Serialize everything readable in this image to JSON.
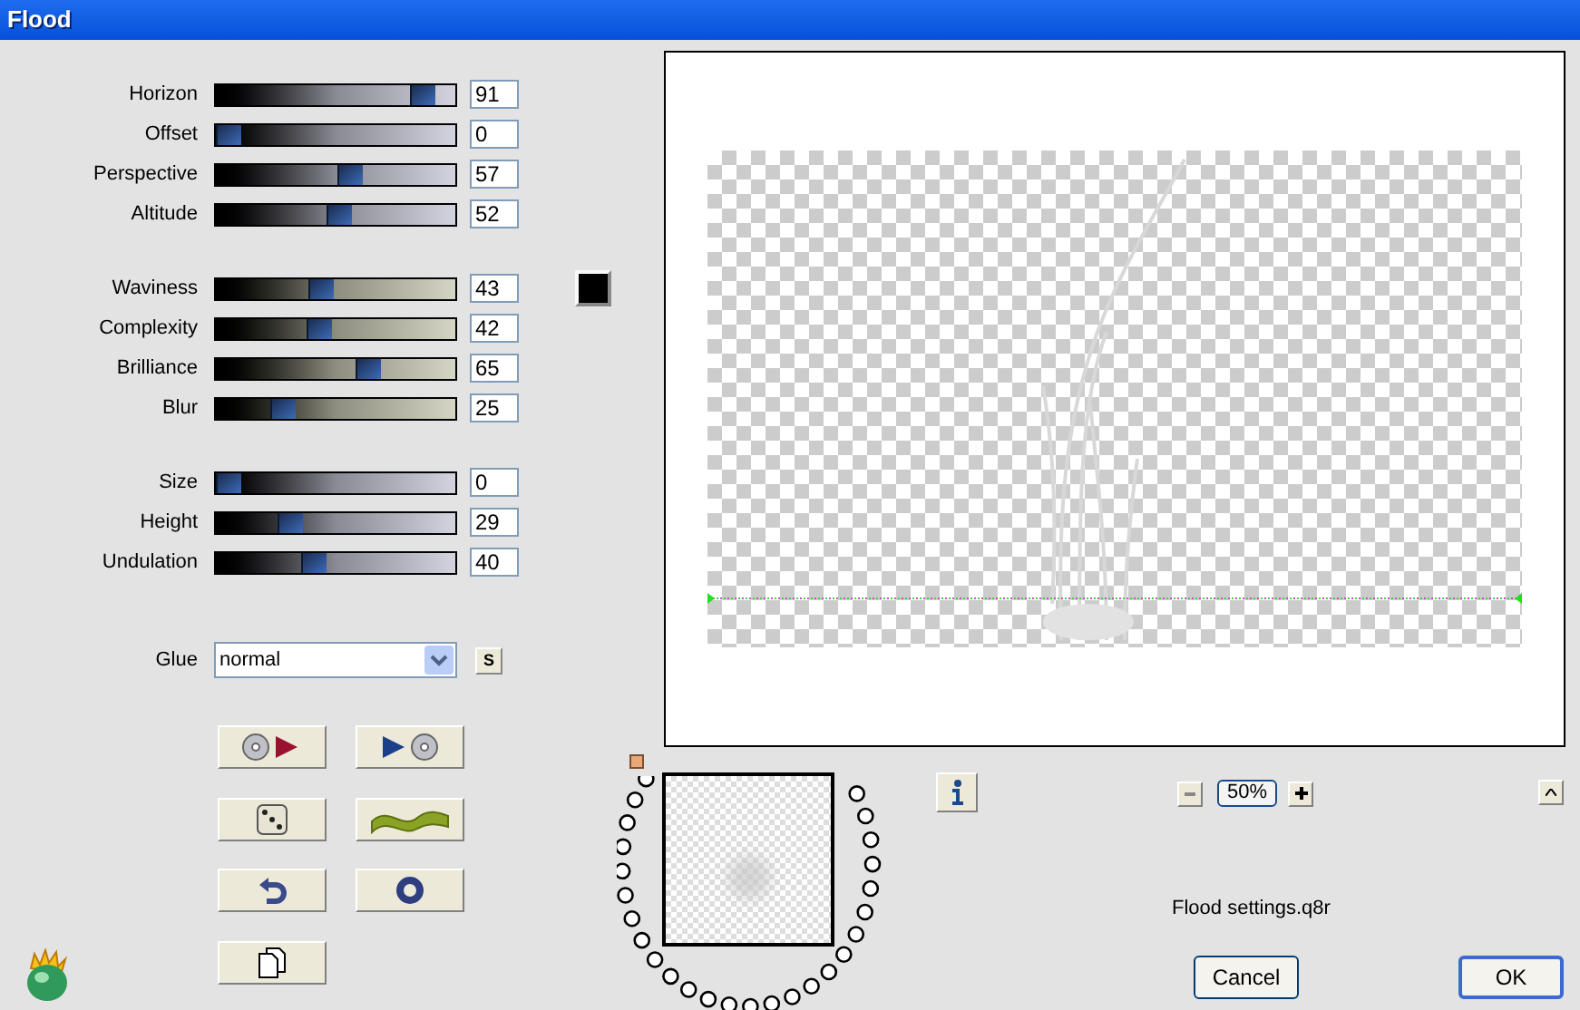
{
  "window": {
    "title": "Flood"
  },
  "slider_groups": [
    {
      "sliders": [
        {
          "label": "Horizon",
          "value": "91",
          "level": 0.91
        },
        {
          "label": "Offset",
          "value": "0",
          "level": 0
        },
        {
          "label": "Perspective",
          "value": "57",
          "level": 0.57
        },
        {
          "label": "Altitude",
          "value": "52",
          "level": 0.52
        }
      ]
    },
    {
      "sliders": [
        {
          "label": "Waviness",
          "value": "43",
          "level": 0.43
        },
        {
          "label": "Complexity",
          "value": "42",
          "level": 0.42
        },
        {
          "label": "Brilliance",
          "value": "65",
          "level": 0.65
        },
        {
          "label": "Blur",
          "value": "25",
          "level": 0.25
        }
      ]
    },
    {
      "sliders": [
        {
          "label": "Size",
          "value": "0",
          "level": 0
        },
        {
          "label": "Height",
          "value": "29",
          "level": 0.29
        },
        {
          "label": "Undulation",
          "value": "40",
          "level": 0.4
        }
      ]
    }
  ],
  "swatch": {
    "color": "#000000"
  },
  "glue": {
    "label": "Glue",
    "value": "normal",
    "button": "S"
  },
  "zoom": {
    "value": "50%"
  },
  "settings_file": "Flood settings.q8r",
  "buttons": [
    "Cancel",
    "OK"
  ]
}
